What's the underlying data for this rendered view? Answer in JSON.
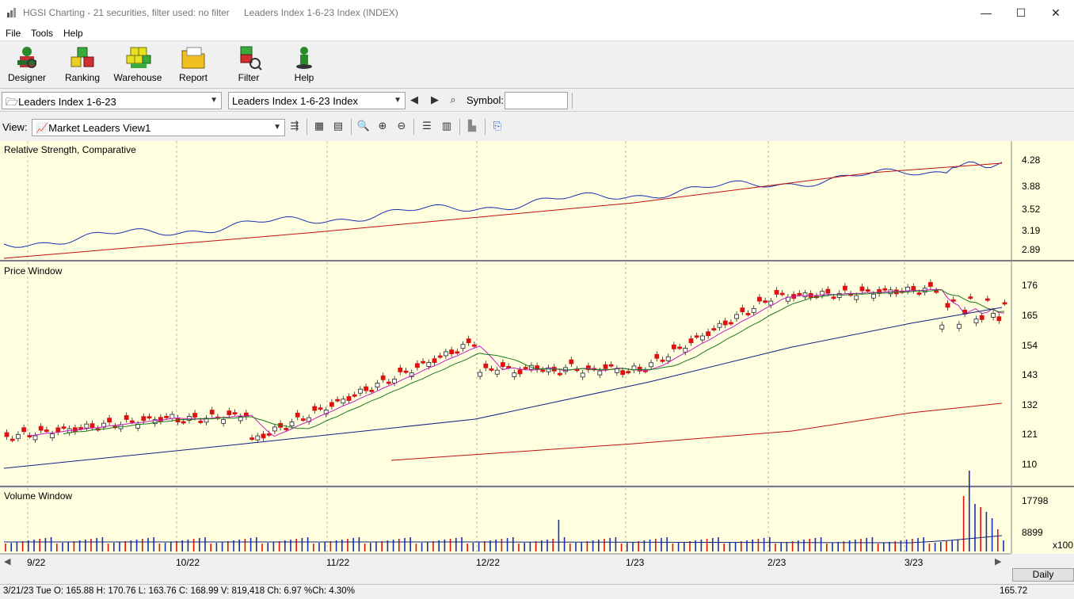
{
  "window": {
    "title": "HGSI Charting - 21 securities, filter used: no filter",
    "subtitle": "Leaders Index 1-6-23 Index (INDEX)",
    "minimize": "—",
    "maximize": "☐",
    "close": "✕"
  },
  "menu": [
    "File",
    "Tools",
    "Help"
  ],
  "toolbar": {
    "buttons": [
      {
        "label": "Designer",
        "icon": "designer-icon"
      },
      {
        "label": "Ranking",
        "icon": "ranking-icon"
      },
      {
        "label": "Warehouse",
        "icon": "warehouse-icon"
      },
      {
        "label": "Report",
        "icon": "report-icon"
      },
      {
        "label": "Filter",
        "icon": "filter-icon"
      },
      {
        "label": "Help",
        "icon": "help-icon"
      }
    ]
  },
  "selectors": {
    "list": "Leaders Index 1-6-23",
    "security": "Leaders Index 1-6-23 Index",
    "symbol_label": "Symbol:",
    "symbol_value": "",
    "view_label": "View:",
    "view": "Market Leaders View1"
  },
  "chart_data": {
    "type": "candlestick",
    "panes": [
      {
        "title": "Relative Strength, Comparative",
        "y_ticks": [
          "4.28",
          "3.88",
          "3.52",
          "3.19",
          "2.89"
        ],
        "series": [
          {
            "color": "#1a2fb0"
          },
          {
            "color": "#c01010"
          }
        ]
      },
      {
        "title": "Price Window",
        "y_ticks": [
          "176",
          "165",
          "154",
          "143",
          "132",
          "121",
          "110"
        ],
        "moving_averages": [
          {
            "color": "#c020c0"
          },
          {
            "color": "#1a7a1a"
          },
          {
            "color": "#102080"
          },
          {
            "color": "#c01010"
          }
        ]
      },
      {
        "title": "Volume Window",
        "y_ticks": [
          "17798",
          "8899"
        ],
        "unit": "x100"
      }
    ],
    "x_ticks": [
      "9/22",
      "10/22",
      "11/22",
      "12/22",
      "1/23",
      "2/23",
      "3/23"
    ],
    "grid": true,
    "up_color": "#1a2fb0",
    "down_color": "#e01010"
  },
  "timeframe": "Daily",
  "status": {
    "text": "3/21/23 Tue O: 165.88 H: 170.76 L: 163.76 C: 168.99 V: 819,418 Ch: 6.97 %Ch: 4.30%",
    "price": "165.72"
  }
}
